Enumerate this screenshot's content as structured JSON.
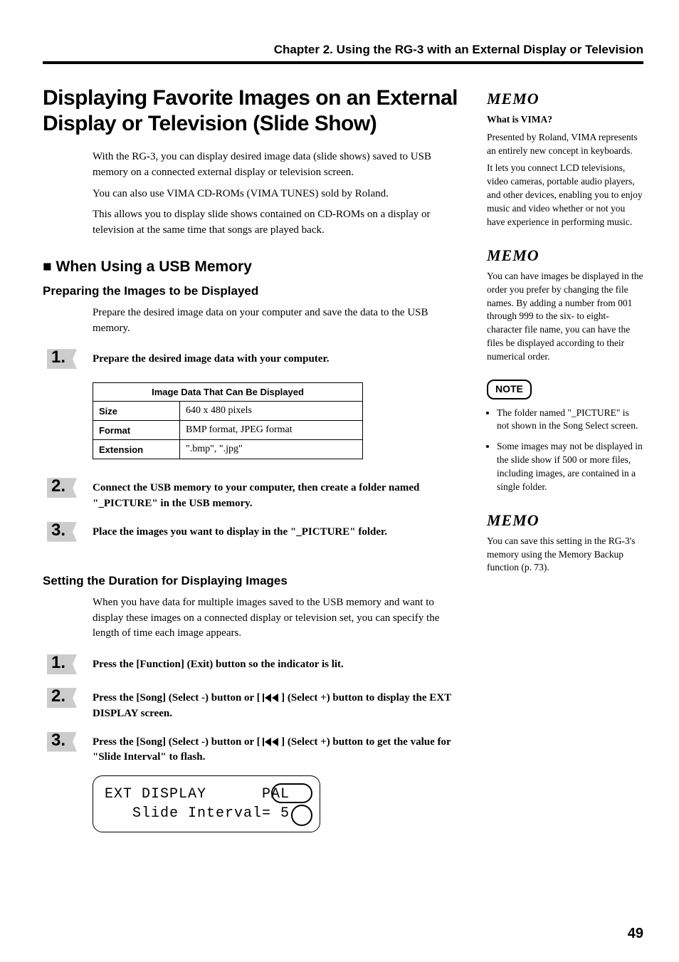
{
  "chapter_head": "Chapter 2. Using the RG-3 with an External Display or Television",
  "title": "Displaying Favorite Images on an External Display or Television (Slide Show)",
  "intro": [
    "With the RG-3, you can display desired image data (slide shows) saved to USB memory on a connected external display or television screen.",
    "You can also use VIMA CD-ROMs (VIMA TUNES) sold by Roland.",
    "This allows you to display slide shows contained on CD-ROMs on a display or television at the same time that songs are played back."
  ],
  "sec1_title": "■ When Using a USB Memory",
  "sub1_title": "Preparing the Images to be Displayed",
  "sub1_lead": "Prepare the desired image data on your computer and save the data to the USB memory.",
  "step_a1": "Prepare the desired image data with your computer.",
  "table_head": "Image Data That Can Be Displayed",
  "table_rows": [
    {
      "k": "Size",
      "v": "640 x 480 pixels"
    },
    {
      "k": "Format",
      "v": "BMP format, JPEG format"
    },
    {
      "k": "Extension",
      "v": "\".bmp\", \".jpg\""
    }
  ],
  "step_a2": "Connect the USB memory to your computer, then create a folder named \"_PICTURE\" in the USB memory.",
  "step_a3": "Place the images you want to display in the \"_PICTURE\" folder.",
  "sub2_title": "Setting the Duration for Displaying Images",
  "sub2_lead": "When you have data for multiple images saved to the USB memory and want to display these images on a connected display or television set, you can specify the length of time each image appears.",
  "step_b1": "Press the [Function] (Exit) button so the indicator is lit.",
  "step_b2_a": "Press the [Song] (Select -) button or [ ",
  "step_b2_b": " ] (Select +) button to display the EXT DISPLAY screen.",
  "step_b3_a": "Press the [Song] (Select -) button or [ ",
  "step_b3_b": " ] (Select +) button to get the value for \"Slide Interval\" to flash.",
  "lcd_row1": "EXT DISPLAY      PAL",
  "lcd_row2": "   Slide Interval= 5",
  "memo1_title": "What is VIMA?",
  "memo1_p1": "Presented by Roland, VIMA represents an entirely new concept in keyboards.",
  "memo1_p2": "It lets you connect LCD televisions, video cameras, portable audio players, and other devices, enabling you to enjoy music and video whether or not you have experience in performing music.",
  "memo2_p": "You can have images be displayed in the order you prefer by changing the file names. By adding a number from 001 through 999 to the six- to eight-character file name, you can have the files be displayed according to their numerical order.",
  "note_li1": "The folder named \"_PICTURE\" is not shown in the Song Select screen.",
  "note_li2": "Some images may not be displayed in the slide show if 500 or more files, including images, are contained in a single folder.",
  "memo3_p": "You can save this setting in the RG-3's memory using the Memory Backup function (p. 73).",
  "memo_label": "MEMO",
  "note_label": "NOTE",
  "page_num": "49",
  "nums": {
    "one": "1.",
    "two": "2.",
    "three": "3."
  }
}
